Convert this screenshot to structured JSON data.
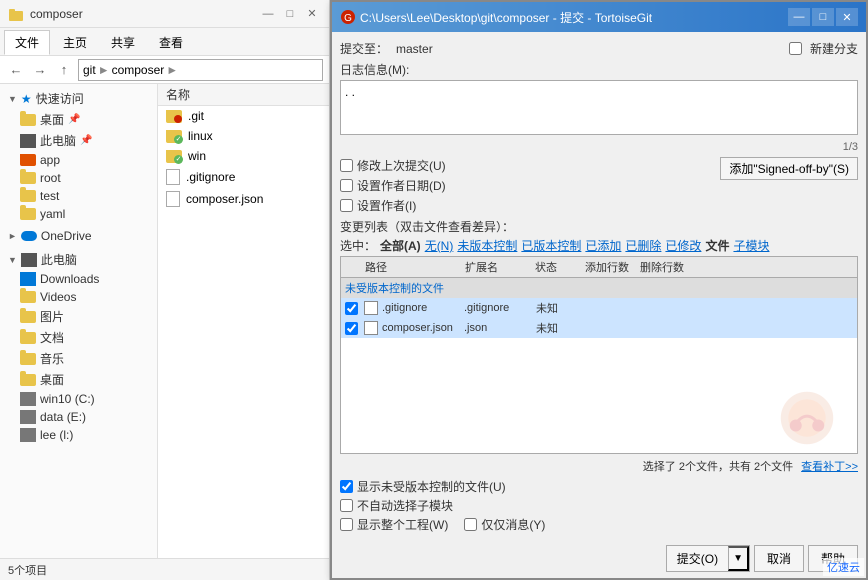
{
  "explorer": {
    "title": "composer",
    "titlebar_icon": "folder",
    "ribbon_tabs": [
      "文件",
      "主页",
      "共享",
      "查看"
    ],
    "active_tab": "主页",
    "breadcrumb": [
      "git",
      "composer"
    ],
    "sidebar_sections": [
      {
        "label": "快速访问",
        "icon": "star",
        "items": [
          {
            "label": "桌面",
            "icon": "folder",
            "pinned": true
          },
          {
            "label": "此电脑",
            "icon": "computer",
            "pinned": true
          },
          {
            "label": "app",
            "icon": "folder"
          },
          {
            "label": "root",
            "icon": "folder"
          },
          {
            "label": "test",
            "icon": "folder"
          },
          {
            "label": "yaml",
            "icon": "folder"
          }
        ]
      },
      {
        "label": "OneDrive",
        "icon": "onedrive"
      },
      {
        "label": "此电脑",
        "icon": "computer",
        "items": [
          {
            "label": "Downloads",
            "icon": "download"
          },
          {
            "label": "Videos",
            "icon": "folder"
          },
          {
            "label": "图片",
            "icon": "folder"
          },
          {
            "label": "文档",
            "icon": "folder"
          },
          {
            "label": "音乐",
            "icon": "folder"
          },
          {
            "label": "桌面",
            "icon": "folder"
          },
          {
            "label": "win10 (C:)",
            "icon": "drive"
          },
          {
            "label": "data (E:)",
            "icon": "drive"
          },
          {
            "label": "lee (l:)",
            "icon": "drive"
          }
        ]
      }
    ],
    "status_bar": "5个项目",
    "files": [
      {
        "name": ".git",
        "icon": "git-folder"
      },
      {
        "name": "linux",
        "icon": "git-ok-folder"
      },
      {
        "name": "win",
        "icon": "git-ok-folder"
      },
      {
        "name": ".gitignore",
        "icon": "file"
      },
      {
        "name": "composer.json",
        "icon": "file"
      }
    ]
  },
  "dialog": {
    "title": "C:\\Users\\Lee\\Desktop\\git\\composer - 提交 - TortoiseGit",
    "title_icon": "tortoisegit",
    "win_buttons": [
      "—",
      "□",
      "✕"
    ],
    "commit_label": "提交至：",
    "branch": "master",
    "new_branch_label": "新建分支",
    "log_label": "日志信息(M):",
    "log_value": ". .",
    "page_counter": "1/3",
    "checkboxes": [
      {
        "id": "amend",
        "label": "修改上次提交(U)",
        "checked": false
      },
      {
        "id": "author_date",
        "label": "设置作者日期(D)",
        "checked": false
      },
      {
        "id": "set_author",
        "label": "设置作者(I)",
        "checked": false
      }
    ],
    "add_signed_btn": "添加\"Signed-off-by\"(S)",
    "changes_label": "变更列表（双击文件查看差异）：",
    "select_label": "选中：",
    "tabs": [
      {
        "label": "全部(A)",
        "selected": true
      },
      {
        "label": "无(N)"
      },
      {
        "label": "未版本控制"
      },
      {
        "label": "已版本控制"
      },
      {
        "label": "已添加"
      },
      {
        "label": "已删除"
      },
      {
        "label": "已修改"
      },
      {
        "label": "文件",
        "selected": true
      },
      {
        "label": "子模块"
      }
    ],
    "table_headers": [
      "路径",
      "扩展名",
      "状态",
      "添加行数",
      "删除行数"
    ],
    "group_header": "未受版本控制的文件",
    "files": [
      {
        "checked": true,
        "name": ".gitignore",
        "ext": ".gitignore",
        "status": "未知",
        "add": "",
        "del": ""
      },
      {
        "checked": true,
        "name": "composer.json",
        "ext": ".json",
        "status": "未知",
        "add": "",
        "del": ""
      }
    ],
    "summary": "选择了 2个文件，共有 2个文件",
    "view_diff": "查看补丁>>",
    "bottom_checkboxes": [
      {
        "id": "show_unversioned",
        "label": "☑显示未受版本控制的文件(U)",
        "checked": true
      },
      {
        "id": "no_auto_select",
        "label": "□不自动选择子模块",
        "checked": false
      },
      {
        "id": "show_whole_project",
        "label": "□显示整个工程(W)",
        "checked": false
      },
      {
        "id": "only_messages",
        "label": "□仅仅消息(Y)",
        "checked": false
      }
    ],
    "buttons": [
      {
        "label": "提交(O)",
        "type": "split"
      },
      {
        "label": "取消"
      },
      {
        "label": "帮助"
      }
    ]
  }
}
